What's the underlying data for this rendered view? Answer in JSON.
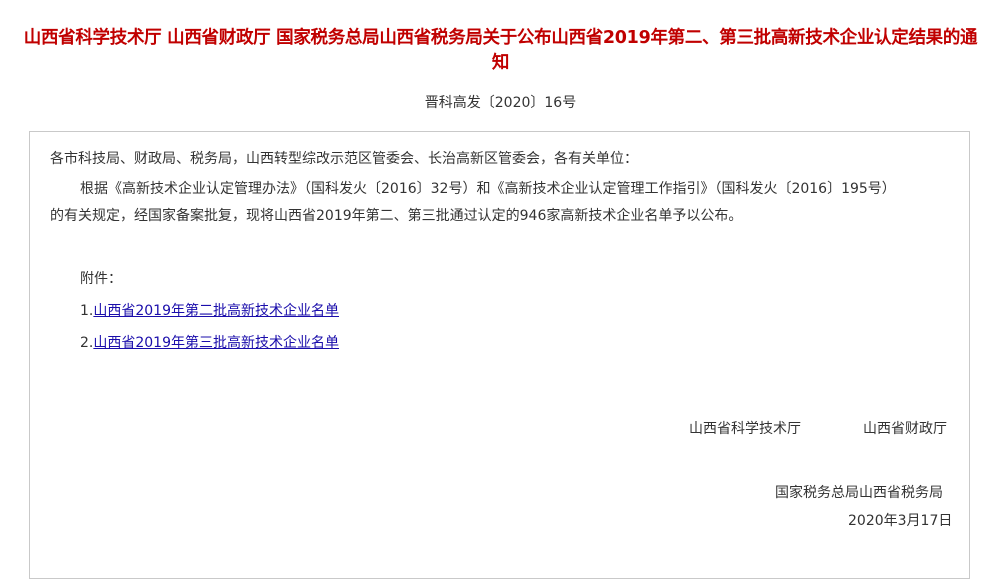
{
  "notice": {
    "title_line1": "山西省科学技术厅 山西省财政厅 国家税务总局山西省税务局关于公布山西省2019年第二、第三批高新技术企业认定结果的通",
    "title_line2": "知",
    "doc_number": "晋科高发〔2020〕16号",
    "salutation": "各市科技局、财政局、税务局，山西转型综改示范区管委会、长治高新区管委会，各有关单位：",
    "body_line1": "根据《高新技术企业认定管理办法》（国科发火〔2016〕32号）和《高新技术企业认定管理工作指引》（国科发火〔2016〕195号）",
    "body_line2": "的有关规定，经国家备案批复，现将山西省2019年第二、第三批通过认定的946家高新技术企业名单予以公布。",
    "attachments_label": "附件：",
    "attachments": [
      {
        "number": "1.",
        "link_text": "山西省2019年第二批高新技术企业名单"
      },
      {
        "number": "2.",
        "link_text": "山西省2019年第三批高新技术企业名单"
      }
    ],
    "signatories": {
      "science_dept": "山西省科学技术厅",
      "finance_dept": "山西省财政厅",
      "tax_bureau": "国家税务总局山西省税务局"
    },
    "date": "2020年3月17日"
  }
}
